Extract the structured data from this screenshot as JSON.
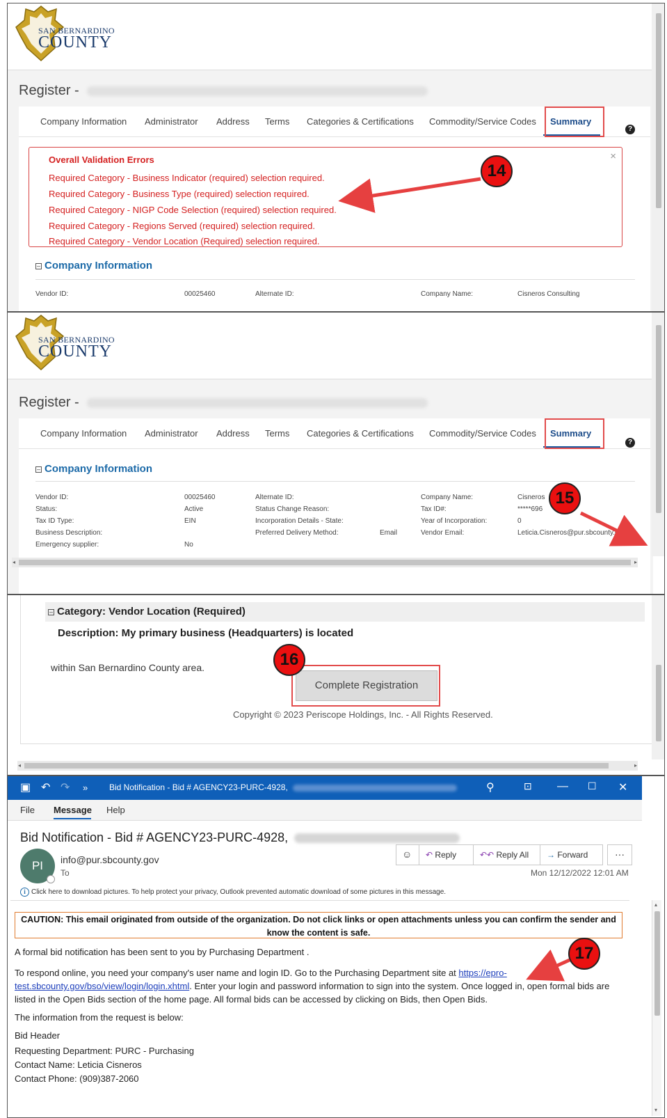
{
  "register": {
    "logo_line1": "SAN BERNARDINO",
    "logo_line2": "COUNTY",
    "title_prefix": "Register -",
    "tabs": [
      {
        "label": "Company Information"
      },
      {
        "label": "Administrator"
      },
      {
        "label": "Address"
      },
      {
        "label": "Terms"
      },
      {
        "label": "Categories & Certifications"
      },
      {
        "label": "Commodity/Service Codes"
      },
      {
        "label": "Summary"
      }
    ],
    "help_icon": "question-circle-icon",
    "validation": {
      "title": "Overall Validation Errors",
      "close": "×",
      "items": [
        "Required Category - Business Indicator (required) selection required.",
        "Required Category - Business Type (required) selection required.",
        "Required Category - NIGP Code Selection (required) selection required.",
        "Required Category - Regions Served (required) selection required.",
        "Required Category - Vendor Location (Required) selection required."
      ]
    },
    "section_company": "Company Information",
    "fields": {
      "vendor_id_label": "Vendor ID:",
      "vendor_id_value": "00025460",
      "alternate_id_label": "Alternate ID:",
      "company_name_label": "Company Name:",
      "company_name_value": "Cisneros Consulting",
      "company_name_short": "Cisneros",
      "status_label": "Status:",
      "status_value": "Active",
      "status_change_label": "Status Change Reason:",
      "tax_id_label": "Tax ID#:",
      "tax_id_value": "*****696",
      "tax_id_type_label": "Tax ID Type:",
      "tax_id_type_value": "EIN",
      "incorporation_label": "Incorporation Details - State:",
      "year_label": "Year of Incorporation:",
      "year_value": "0",
      "business_desc_label": "Business Description:",
      "delivery_label": "Preferred Delivery Method:",
      "delivery_value": "Email",
      "vendor_email_label": "Vendor Email:",
      "vendor_email_value": "Leticia.Cisneros@pur.sbcounty.g",
      "emergency_label": "Emergency supplier:",
      "emergency_value": "No"
    }
  },
  "badges": {
    "b14": "14",
    "b15": "15",
    "b16": "16",
    "b17": "17"
  },
  "completion": {
    "category": "Category: Vendor Location (Required)",
    "description": "Description: My primary business (Headquarters) is located",
    "within": "within San Bernardino County area.",
    "button": "Complete Registration",
    "copyright": "Copyright © 2023 Periscope Holdings, Inc. - All Rights Reserved."
  },
  "outlook": {
    "window_title": "Bid Notification - Bid # AGENCY23-PURC-4928,",
    "menus": [
      "File",
      "Message",
      "Help"
    ],
    "subject": "Bid Notification - Bid # AGENCY23-PURC-4928,",
    "avatar": "PI",
    "sender": "info@pur.sbcounty.gov",
    "to": "To",
    "actions": {
      "reply": "Reply",
      "reply_all": "Reply All",
      "forward": "Forward",
      "more": "···"
    },
    "date": "Mon 12/12/2022 12:01 AM",
    "info_text": "Click here to download pictures. To help protect your privacy, Outlook prevented automatic download of some pictures in this message.",
    "caution": "CAUTION: This email originated from outside of the organization. Do not click links or open attachments unless you can confirm the sender and know the content is safe.",
    "p1": "A formal bid notification has been sent to you by Purchasing Department .",
    "p2_a": "To respond online, you need your company's user name and login ID. Go to the Purchasing Department site at ",
    "p2_link": "https://epro-test.sbcounty.gov/bso/view/login/login.xhtml",
    "p2_b": ". Enter your login and password information to sign into the system. Once logged in, open formal bids are listed in the Open Bids section of the home page. All formal bids can be accessed by clicking on Bids, then Open Bids.",
    "p3": "The information from the request is below:",
    "p4": "Bid Header",
    "p5": "Requesting Department: PURC - Purchasing",
    "p6": "Contact Name: Leticia Cisneros",
    "p7": "Contact Phone: (909)387-2060"
  },
  "colors": {
    "accent": "#1c6aa8",
    "error": "#d42020",
    "highlight": "#e24b4b",
    "badge": "#ea1010",
    "titlebar": "#0f5fb8"
  }
}
